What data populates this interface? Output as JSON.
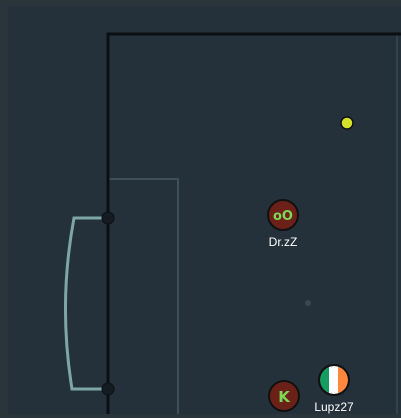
{
  "players": [
    {
      "name": "Dr.zZ",
      "avatar_text": "oO",
      "avatar_text_color": "#7ed957",
      "avatar_bg": "#6b2018"
    },
    {
      "name": "",
      "avatar_text": "K",
      "avatar_text_color": "#7ed957",
      "avatar_bg": "#6b2018"
    },
    {
      "name": "Lupz27",
      "avatar_icon": "ireland-flag-icon",
      "avatar_colors": [
        "#169b62",
        "#ffffff",
        "#ff883e"
      ]
    }
  ],
  "ball": {
    "icon": "ball-icon",
    "color": "#d6e02a"
  },
  "colors": {
    "pitch": "#24313a",
    "goal_line": "#0b0f12",
    "area_line": "#4a5a62",
    "goal_net": "#7ea6a8",
    "frame": "#2a343b"
  }
}
